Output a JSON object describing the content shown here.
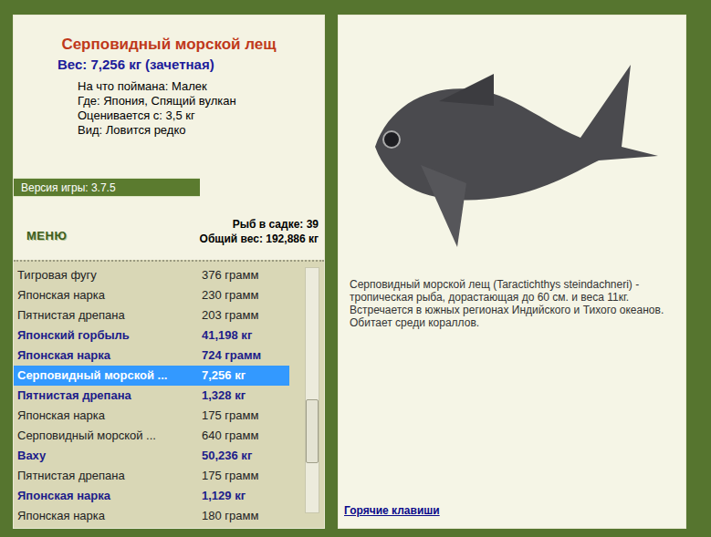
{
  "fish": {
    "title": "Серповидный морской лещ",
    "weight": "Вес: 7,256 кг (зачетная)",
    "details": [
      "На что поймана: Малек",
      "Где: Япония, Спящий вулкан",
      "Оценивается с: 3,5 кг",
      "Вид: Ловится редко"
    ]
  },
  "version": "Версия игры: 3.7.5",
  "menu_button": "МЕНЮ",
  "summary": [
    "Рыб в садке: 39",
    "Общий вес: 192,886 кг"
  ],
  "catch_list": [
    {
      "name": "Тигровая фугу",
      "weight": "376 грамм",
      "trophy": false,
      "selected": false
    },
    {
      "name": "Японская нарка",
      "weight": "230 грамм",
      "trophy": false,
      "selected": false
    },
    {
      "name": "Пятнистая дрепана",
      "weight": "203 грамм",
      "trophy": false,
      "selected": false
    },
    {
      "name": "Японский горбыль",
      "weight": "41,198 кг",
      "trophy": true,
      "selected": false
    },
    {
      "name": "Японская нарка",
      "weight": "724 грамм",
      "trophy": true,
      "selected": false
    },
    {
      "name": "Серповидный морской ...",
      "weight": "7,256 кг",
      "trophy": true,
      "selected": true
    },
    {
      "name": "Пятнистая дрепана",
      "weight": "1,328 кг",
      "trophy": true,
      "selected": false
    },
    {
      "name": "Японская нарка",
      "weight": "175 грамм",
      "trophy": false,
      "selected": false
    },
    {
      "name": "Серповидный морской ...",
      "weight": "640 грамм",
      "trophy": false,
      "selected": false
    },
    {
      "name": "Ваху",
      "weight": "50,236 кг",
      "trophy": true,
      "selected": false
    },
    {
      "name": "Пятнистая дрепана",
      "weight": "175 грамм",
      "trophy": false,
      "selected": false
    },
    {
      "name": "Японская нарка",
      "weight": "1,129 кг",
      "trophy": true,
      "selected": false
    },
    {
      "name": "Японская нарка",
      "weight": "180 грамм",
      "trophy": false,
      "selected": false
    }
  ],
  "scrollbar": {
    "level": 0.72
  },
  "description": "Серповидный морской лещ (Taractichthys steindachneri) - тропическая рыба, дорастающая до 60 см. и веса 11кг. Встречается в южных регионах Индийского и Тихого океанов. Обитает среди кораллов.",
  "hotkeys_link": "Горячие клавиши"
}
